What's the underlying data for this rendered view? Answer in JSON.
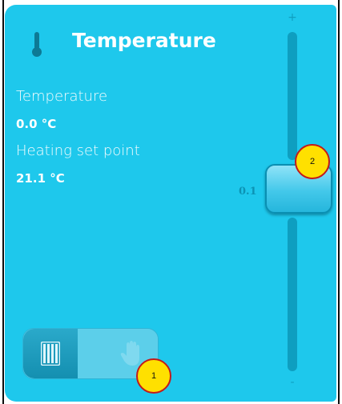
{
  "header": {
    "title": "Temperature",
    "icon": "thermometer-icon"
  },
  "readings": {
    "temperature_label": "Temperature",
    "temperature_value": "0.0 °C",
    "setpoint_label": "Heating set point",
    "setpoint_value": "21.1 °C"
  },
  "slider": {
    "plus_label": "+",
    "minus_label": "-",
    "value_label": "0.1",
    "level": 0.5
  },
  "mode_toggle": {
    "options": [
      "radiator-icon",
      "hand-icon"
    ],
    "selected": "radiator-icon"
  },
  "annotations": {
    "badge_1": "1",
    "badge_2": "2"
  },
  "colors": {
    "panel": "#1ec8ec",
    "accent_dark": "#0e9ec0",
    "badge_fill": "#ffe000",
    "badge_border": "#c31a1a"
  }
}
